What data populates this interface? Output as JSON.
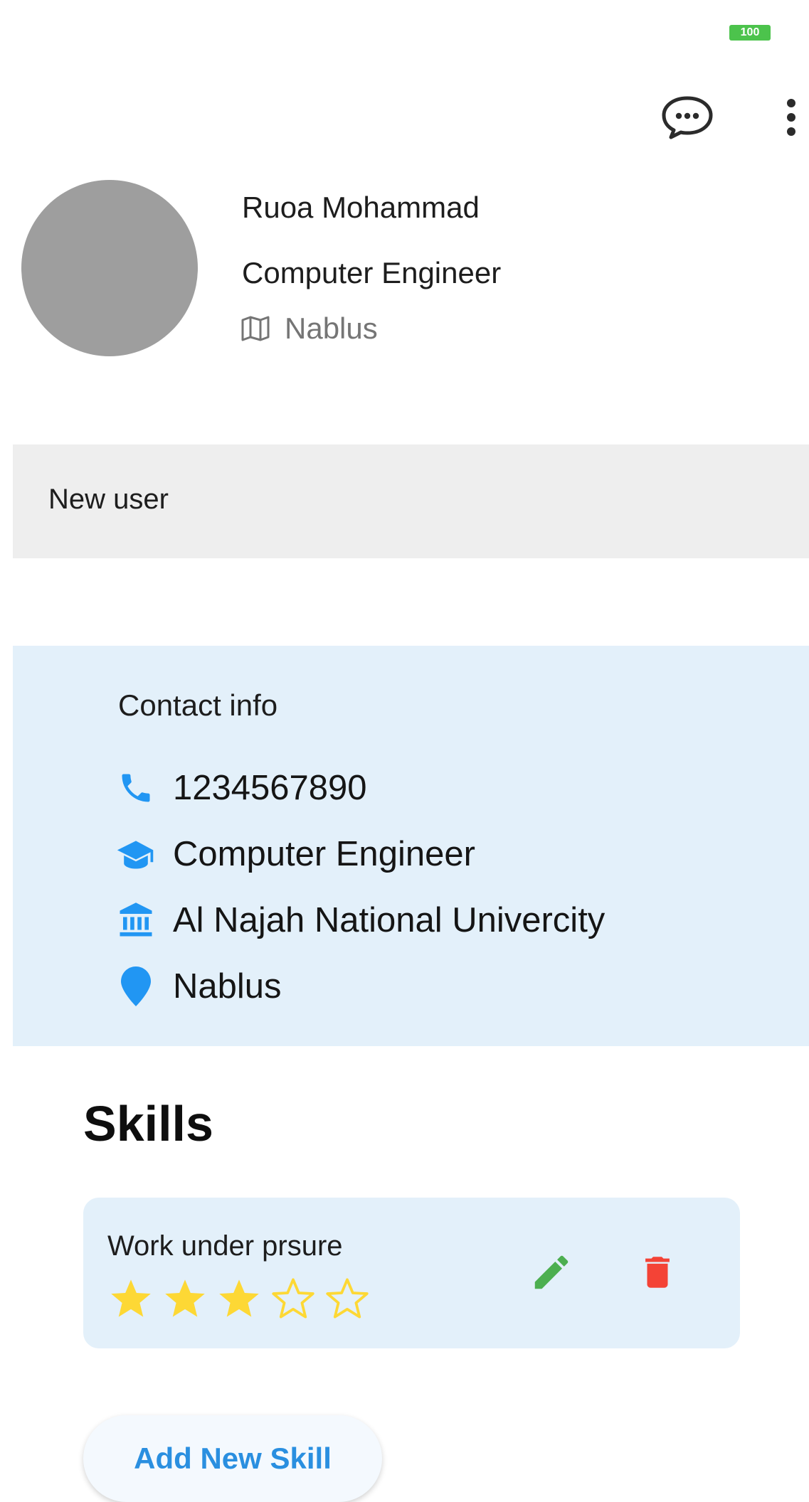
{
  "status": {
    "battery": "100"
  },
  "profile": {
    "name": "Ruoa Mohammad",
    "title": "Computer Engineer",
    "location": "Nablus"
  },
  "account_status": "New user",
  "contact": {
    "heading": "Contact info",
    "phone": "1234567890",
    "major": "Computer Engineer",
    "university": "Al Najah National Univercity",
    "city": "Nablus"
  },
  "skills": {
    "heading": "Skills",
    "items": [
      {
        "name": "Work under prsure",
        "rating": 3,
        "max_rating": 5
      }
    ],
    "add_label": "Add New Skill"
  },
  "colors": {
    "accent": "#2196f3",
    "star": "#fdd835",
    "edit": "#4caf50",
    "delete": "#f44336",
    "battery": "#4cc34c"
  }
}
